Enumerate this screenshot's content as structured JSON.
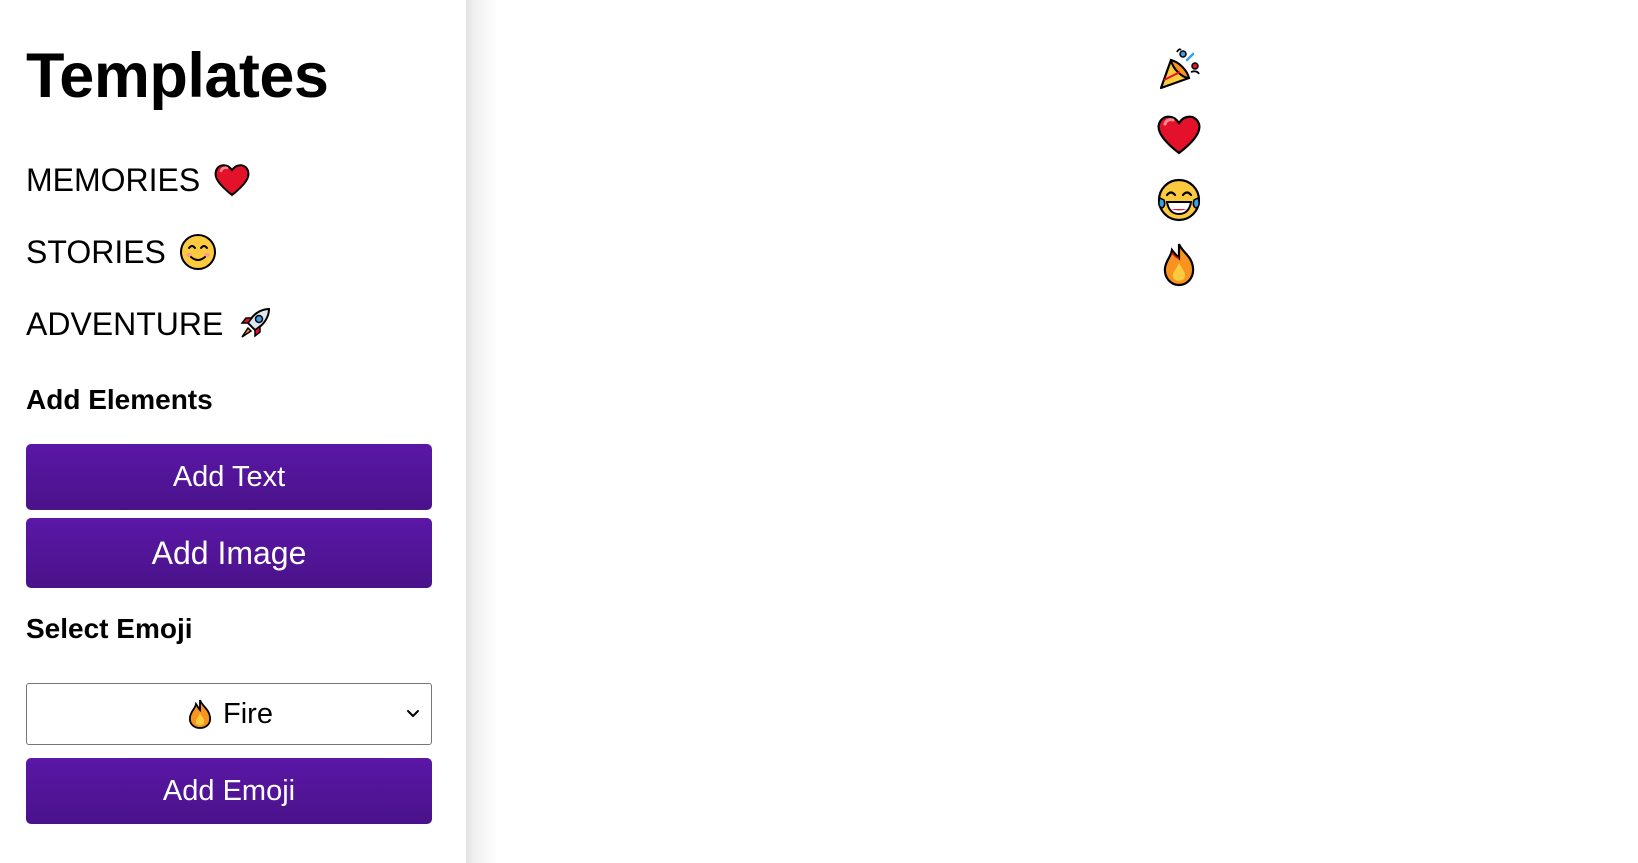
{
  "sidebar": {
    "title": "Templates",
    "templates": [
      {
        "label": "MEMORIES",
        "icon": "red-heart-icon"
      },
      {
        "label": "STORIES",
        "icon": "smiling-face-icon"
      },
      {
        "label": "ADVENTURE",
        "icon": "rocket-icon"
      }
    ],
    "add_elements_heading": "Add Elements",
    "add_text_label": "Add Text",
    "add_image_label": "Add Image",
    "select_emoji_heading": "Select Emoji",
    "emoji_select": {
      "selected_label": "Fire",
      "selected_icon": "fire-icon"
    },
    "add_emoji_label": "Add Emoji"
  },
  "canvas": {
    "emojis": [
      {
        "icon": "party-popper-icon"
      },
      {
        "icon": "red-heart-icon"
      },
      {
        "icon": "tears-of-joy-face-icon"
      },
      {
        "icon": "fire-icon"
      }
    ]
  },
  "colors": {
    "button_purple": "#5a17a6",
    "button_text": "#ffffff",
    "divider_gray": "#ececec"
  }
}
